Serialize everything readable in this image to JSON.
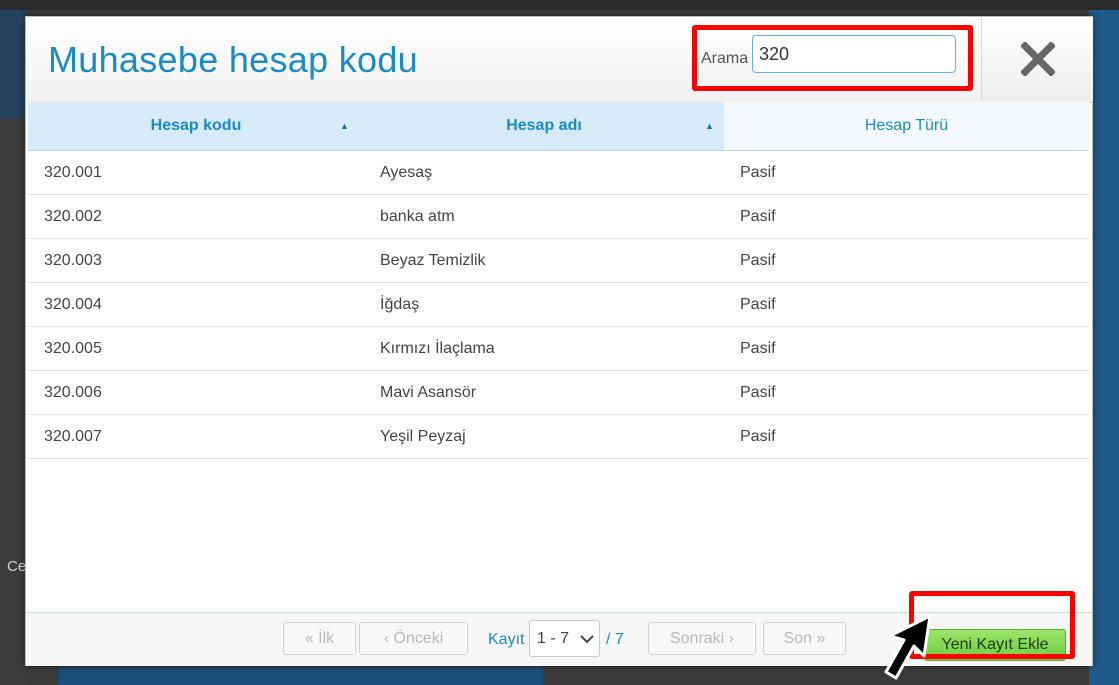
{
  "background": {
    "fragment_text": "Ce"
  },
  "dialog": {
    "title": "Muhasebe hesap kodu",
    "search": {
      "label": "Arama",
      "value": "320"
    },
    "close_icon": "close-x-icon"
  },
  "table": {
    "headers": [
      "Hesap kodu",
      "Hesap adı",
      "Hesap Türü"
    ],
    "rows": [
      [
        "320.001",
        "Ayesaş",
        "Pasif"
      ],
      [
        "320.002",
        "banka atm",
        "Pasif"
      ],
      [
        "320.003",
        "Beyaz Temizlik",
        "Pasif"
      ],
      [
        "320.004",
        "İğdaş",
        "Pasif"
      ],
      [
        "320.005",
        "Kırmızı İlaçlama",
        "Pasif"
      ],
      [
        "320.006",
        "Mavi Asansör",
        "Pasif"
      ],
      [
        "320.007",
        "Yeşil Peyzaj",
        "Pasif"
      ]
    ]
  },
  "pagination": {
    "first": "« İlk",
    "prev": "‹ Önceki",
    "record_label": "Kayıt",
    "range": "1 - 7",
    "total": "/ 7",
    "next": "Sonraki ›",
    "last": "Son »"
  },
  "actions": {
    "new_record": "Yeni Kayıt Ekle"
  },
  "colors": {
    "accent": "#1b8bc4",
    "highlight": "#ff0000",
    "button_green": "#7ed448"
  }
}
